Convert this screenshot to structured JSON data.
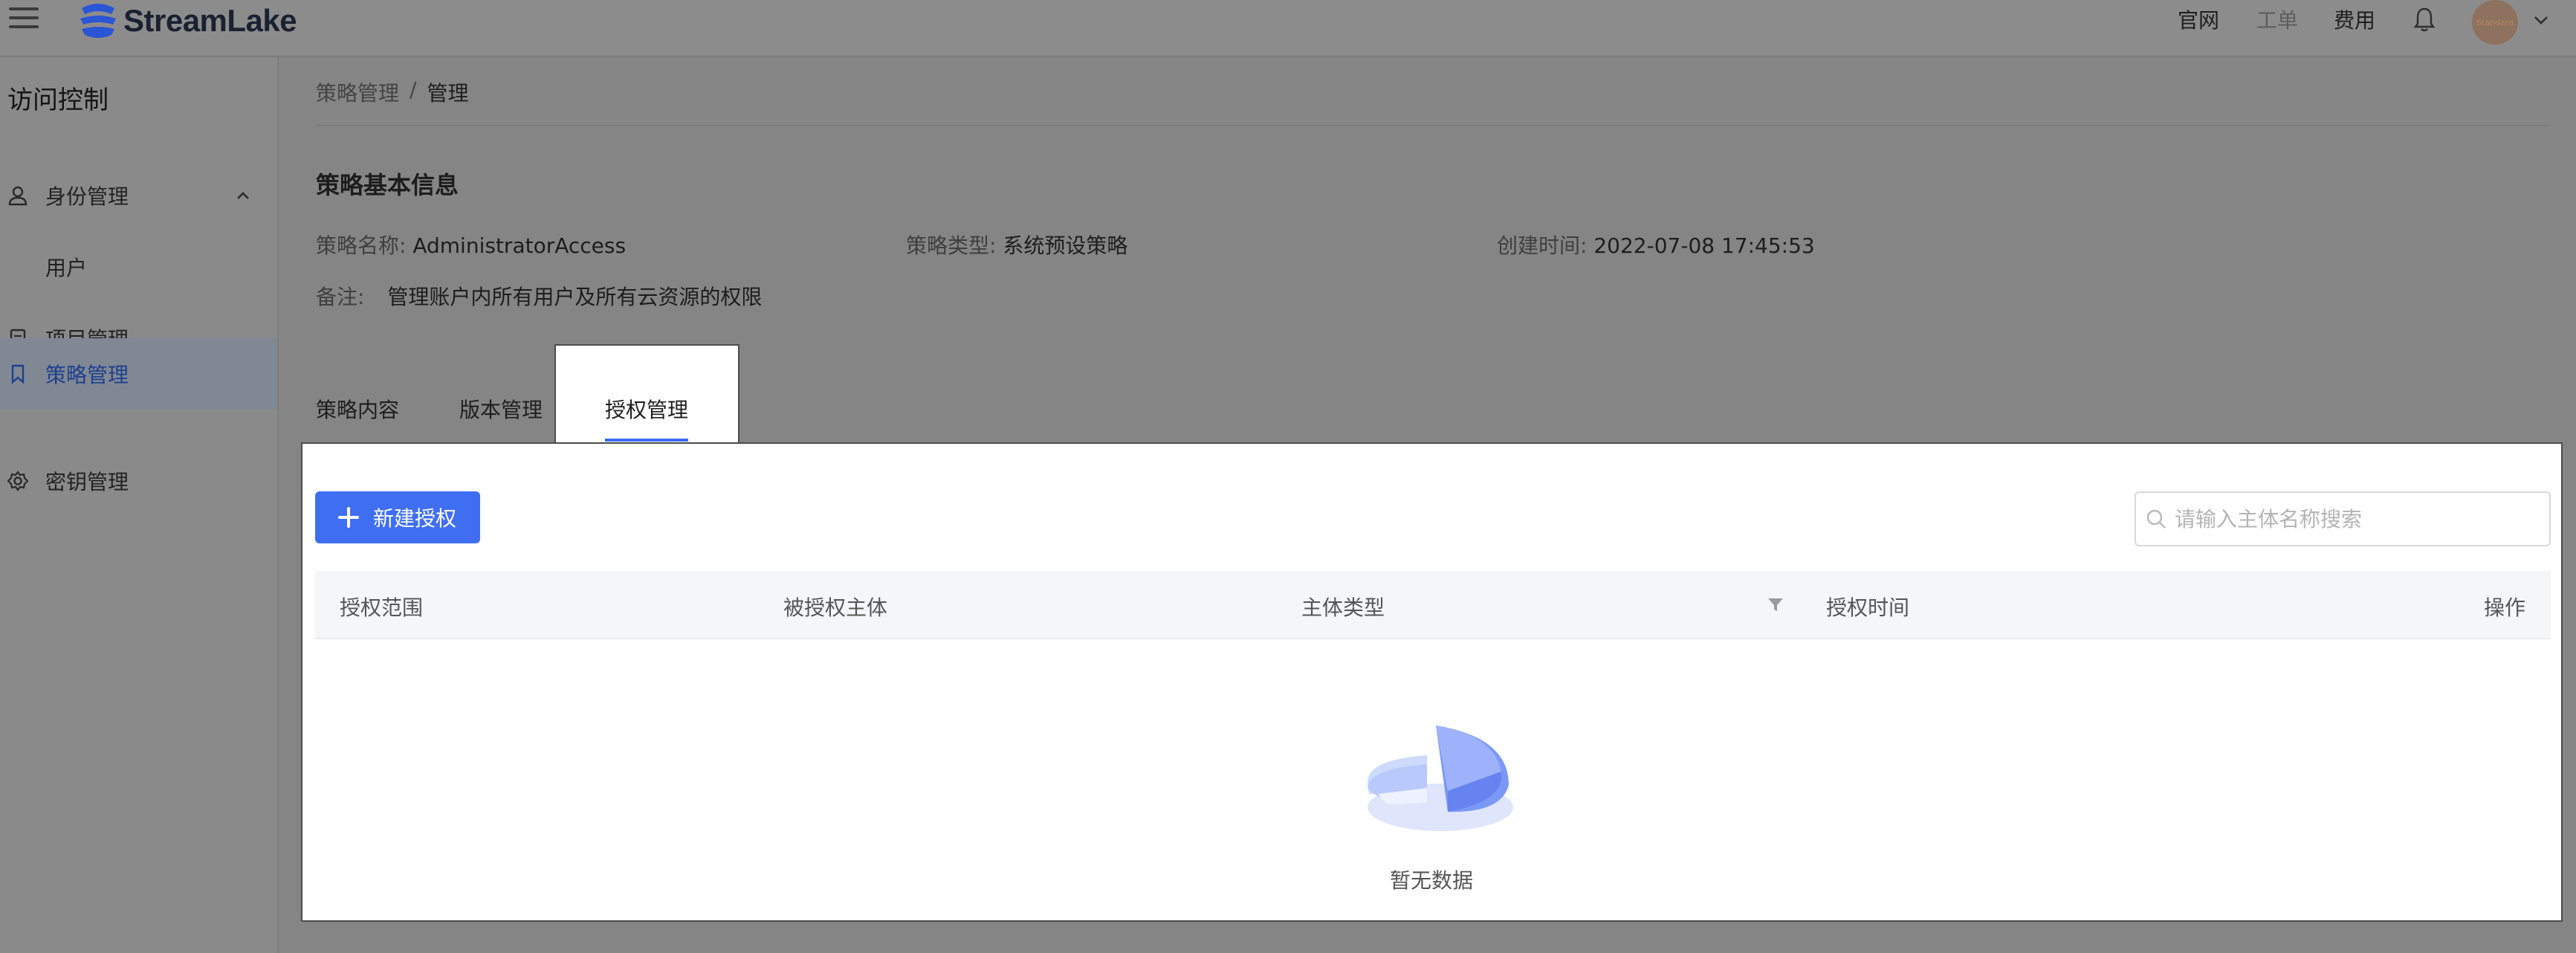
{
  "topbar": {
    "brand": "StreamLake",
    "links": [
      "官网",
      "工单",
      "费用"
    ],
    "avatar_text": "Standard"
  },
  "sidebar": {
    "title": "访问控制",
    "items": [
      {
        "label": "身份管理",
        "icon": "user-icon",
        "expanded": true
      },
      {
        "label": "用户"
      },
      {
        "label": "项目管理",
        "icon": "document-icon"
      },
      {
        "label": "策略管理",
        "icon": "bookmark-icon",
        "active": true
      },
      {
        "label": "密钥管理",
        "icon": "gear-icon"
      }
    ]
  },
  "breadcrumb": {
    "parent": "策略管理",
    "separator": "/",
    "current": "管理"
  },
  "policy_info": {
    "title": "策略基本信息",
    "name_label": "策略名称:",
    "name_value": "AdministratorAccess",
    "type_label": "策略类型:",
    "type_value": "系统预设策略",
    "created_label": "创建时间:",
    "created_value": "2022-07-08 17:45:53",
    "note_label": "备注:",
    "note_value": "管理账户内所有用户及所有云资源的权限"
  },
  "tabs": [
    {
      "label": "策略内容"
    },
    {
      "label": "版本管理"
    },
    {
      "label": "授权管理",
      "active": true
    }
  ],
  "toolbar": {
    "new_button": "新建授权",
    "search_placeholder": "请输入主体名称搜索"
  },
  "table": {
    "columns": [
      "授权范围",
      "被授权主体",
      "主体类型",
      "授权时间",
      "操作"
    ],
    "rows": [],
    "empty_text": "暂无数据"
  },
  "colors": {
    "primary": "#3f6ef2",
    "overlay": "#858585"
  }
}
